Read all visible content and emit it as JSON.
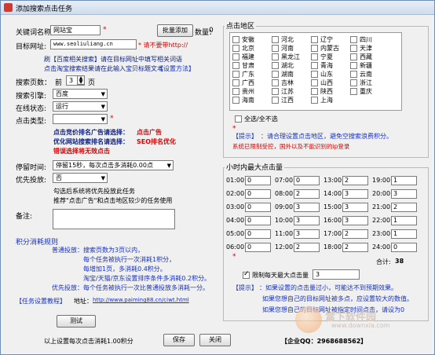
{
  "window": {
    "title": "添加搜索点击任务"
  },
  "left": {
    "keyword_label": "关键词名称:",
    "keyword_value": "网站宝",
    "batch_add_btn": "批量添加",
    "count_label": "数量：",
    "count_value": "0",
    "url_label": "目标网址:",
    "url_value": "www.seoliuliang.cn",
    "url_warning": "* 请不要带http://",
    "hint_line1": "刷【百度相关搜索】请在目标网址中填写相关词语",
    "hint_line2": "点击淘宝搜索结果请在此输入宝贝标题文本",
    "hint_link": "【设置方法】",
    "pages_label": "搜索页数：",
    "pages_prefix": "前",
    "pages_value": "3",
    "pages_suffix": "页",
    "engine_label": "搜索引擎:",
    "engine_value": "百度",
    "status_label": "在线状态:",
    "status_value": "运行",
    "click_type_label": "点击类型:",
    "click_type_value": "",
    "bidding_title": "点击竞价排名广告请选择：",
    "bidding_highlight": "点击广告",
    "seo_title": "优化网站搜索排名请选择：",
    "seo_highlight": "SEO排名优化",
    "warning_line": "错误选择将无效点击",
    "stay_label": "停留时间:",
    "stay_value": "停留15秒，每次点击多消耗0.00点",
    "priority_label": "优先投放:",
    "priority_value": "否",
    "priority_hint1": "勾选后系统将优先投放此任务",
    "priority_hint2": "推荐\"点击广告\"和点击地区较少的任务使用",
    "notes_label": "备注:",
    "rules_title": "积分消耗规则",
    "rule_normal_label": "普通投放：",
    "rule_normal_1": "搜索页数为3页以内，",
    "rule_normal_2": "每个任务被执行一次消耗1积分，",
    "rule_normal_3": "每增加1页，多消耗0.4积分。",
    "rule_normal_4": "淘宝/天猫/京东设置排序条件多消耗0.2积分。",
    "rule_priority_label": "优先投放：",
    "rule_priority_1": "每个任务被执行一次比普通投放多消耗一分。",
    "tutorial_link": "【任务设置教程】",
    "address_label": "地址：",
    "address_url": "http://www.paiming88.cn/ciwt.html",
    "test_btn": "测试",
    "cost_text": "以上设置每次点击消耗1.00积分",
    "save_btn": "保存",
    "close_btn": "关闭",
    "qq_text": "【企业QQ：2968688562】"
  },
  "right": {
    "region_title": "点击地区",
    "regions": [
      {
        "name": "安徽",
        "checked": false
      },
      {
        "name": "河北",
        "checked": false
      },
      {
        "name": "辽宁",
        "checked": false
      },
      {
        "name": "四川",
        "checked": false
      },
      {
        "name": "北京",
        "checked": false
      },
      {
        "name": "河南",
        "checked": false
      },
      {
        "name": "内蒙古",
        "checked": false
      },
      {
        "name": "天津",
        "checked": false
      },
      {
        "name": "福建",
        "checked": false
      },
      {
        "name": "黑龙江",
        "checked": false
      },
      {
        "name": "宁夏",
        "checked": false
      },
      {
        "name": "西藏",
        "checked": false
      },
      {
        "name": "甘肃",
        "checked": false
      },
      {
        "name": "湖北",
        "checked": false
      },
      {
        "name": "青海",
        "checked": false
      },
      {
        "name": "新疆",
        "checked": false
      },
      {
        "name": "广东",
        "checked": false
      },
      {
        "name": "湖南",
        "checked": false
      },
      {
        "name": "山东",
        "checked": false
      },
      {
        "name": "云南",
        "checked": false
      },
      {
        "name": "广西",
        "checked": false
      },
      {
        "name": "吉林",
        "checked": false
      },
      {
        "name": "山西",
        "checked": false
      },
      {
        "name": "浙江",
        "checked": false
      },
      {
        "name": "贵州",
        "checked": false
      },
      {
        "name": "江苏",
        "checked": false
      },
      {
        "name": "陕西",
        "checked": false
      },
      {
        "name": "重庆",
        "checked": false
      },
      {
        "name": "海南",
        "checked": false
      },
      {
        "name": "江西",
        "checked": false
      },
      {
        "name": "上海",
        "checked": false
      }
    ],
    "select_all_label": "全选/全不选",
    "region_tip_label": "【提示】",
    "region_tip_text": "：请合理设置点击地区，避免空搜索浪费积分。",
    "region_tip_red": "系统已限制受控，国外以及不能识别的ip登录",
    "hourly_title": "小时内最大点击量",
    "hours": [
      {
        "time": "01:00",
        "value": "0"
      },
      {
        "time": "07:00",
        "value": "0"
      },
      {
        "time": "13:00",
        "value": "2"
      },
      {
        "time": "19:00",
        "value": "1"
      },
      {
        "time": "02:00",
        "value": "0"
      },
      {
        "time": "08:00",
        "value": "2"
      },
      {
        "time": "14:00",
        "value": "3"
      },
      {
        "time": "20:00",
        "value": "3"
      },
      {
        "time": "03:00",
        "value": "0"
      },
      {
        "time": "09:00",
        "value": "3"
      },
      {
        "time": "15:00",
        "value": "3"
      },
      {
        "time": "21:00",
        "value": "2"
      },
      {
        "time": "04:00",
        "value": "0"
      },
      {
        "time": "10:00",
        "value": "3"
      },
      {
        "time": "16:00",
        "value": "3"
      },
      {
        "time": "22:00",
        "value": "1"
      },
      {
        "time": "05:00",
        "value": "0"
      },
      {
        "time": "11:00",
        "value": "3"
      },
      {
        "time": "17:00",
        "value": "2"
      },
      {
        "time": "23:00",
        "value": "1"
      },
      {
        "time": "06:00",
        "value": "0"
      },
      {
        "time": "12:00",
        "value": "2"
      },
      {
        "time": "18:00",
        "value": "2"
      },
      {
        "time": "24:00",
        "value": "0"
      }
    ],
    "total_label": "合计:",
    "total_value": "38",
    "daily_limit_label": "限制每天最大点击量",
    "daily_limit_value": "3",
    "tip_label": "【提示】",
    "tip_1": "：如果设置的点击量过小，可能达不到预期效果。",
    "tip_2": "如果您想自己的目标网址被多点，应设置较大的数值。",
    "tip_3": "如果您想自己的目标网址被指定时间点击，请设为0"
  },
  "watermark": {
    "text": "當下软件园",
    "url": "www.downxia.com"
  },
  "colors": {
    "red": "#e00000",
    "blue": "#1630c8",
    "navy": "#0a1f8a"
  }
}
